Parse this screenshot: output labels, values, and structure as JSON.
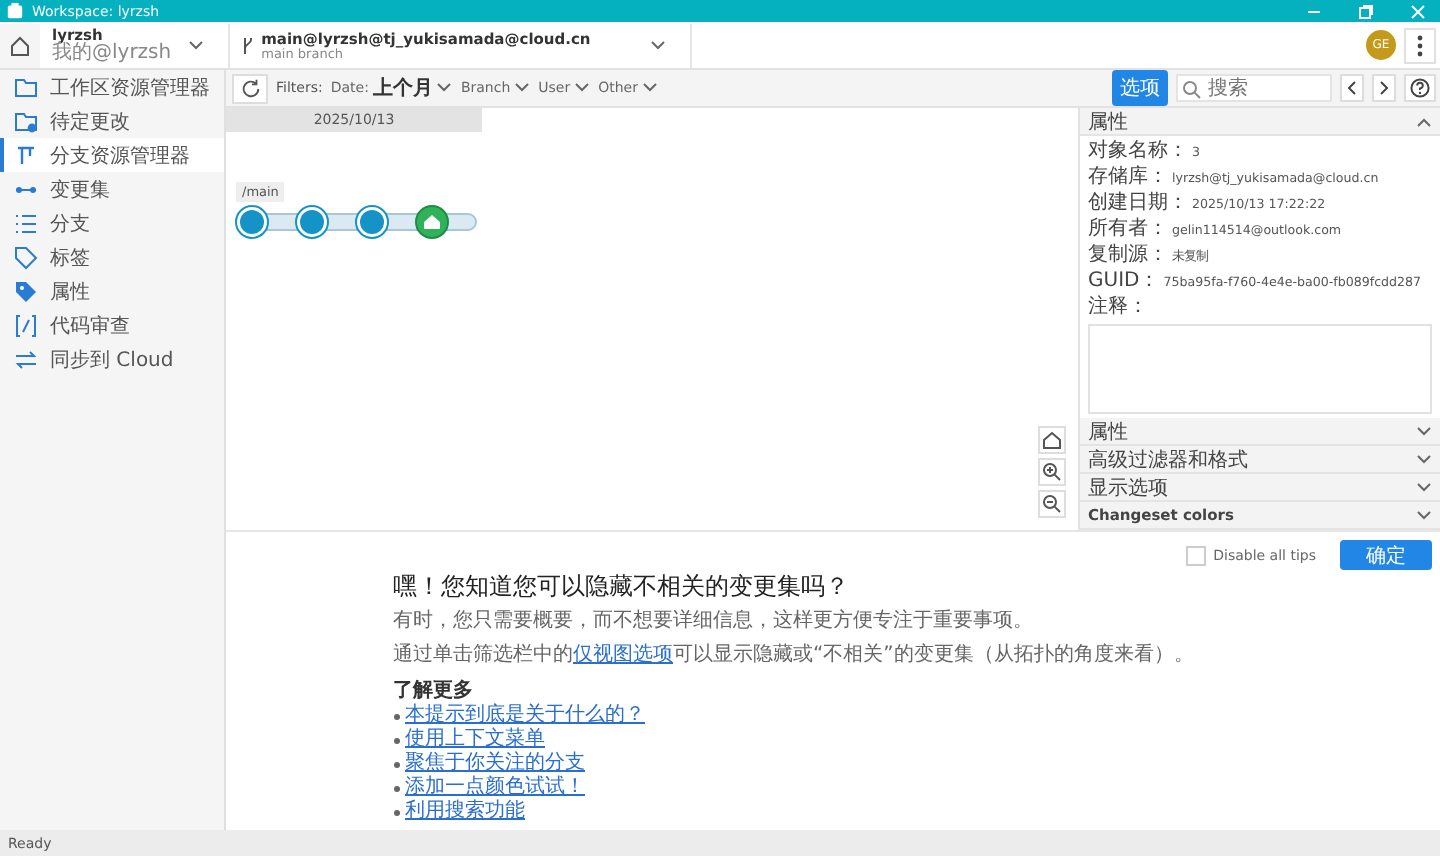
{
  "window": {
    "title": "Workspace: lyrzsh",
    "avatar": "GE"
  },
  "workspace": {
    "name": "lyrzsh",
    "subtitle": "我的@lyrzsh"
  },
  "branch": {
    "name": "main@lyrzsh@tj_yukisamada@cloud.cn",
    "subtitle": "main branch"
  },
  "sidebar": {
    "items": [
      {
        "label": "工作区资源管理器",
        "selected": false
      },
      {
        "label": "待定更改",
        "selected": false
      },
      {
        "label": "分支资源管理器",
        "selected": true
      },
      {
        "label": "变更集",
        "selected": false
      },
      {
        "label": "分支",
        "selected": false
      },
      {
        "label": "标签",
        "selected": false
      },
      {
        "label": "属性",
        "selected": false
      },
      {
        "label": "代码审查",
        "selected": false
      },
      {
        "label": "同步到 Cloud",
        "selected": false
      }
    ]
  },
  "filters": {
    "label": "Filters:",
    "items": [
      {
        "label": "Date:",
        "value": "上个月"
      },
      {
        "label": "Branch"
      },
      {
        "label": "User"
      },
      {
        "label": "Other"
      }
    ]
  },
  "toolbar": {
    "options_button": "选项",
    "search": {
      "placeholder": "搜索"
    }
  },
  "graph": {
    "date": "2025/10/13",
    "branch_label": "/main",
    "nodes": [
      {
        "kind": "changeset"
      },
      {
        "kind": "changeset"
      },
      {
        "kind": "changeset"
      },
      {
        "kind": "head"
      }
    ]
  },
  "properties": {
    "title": "属性",
    "expanded": true,
    "fields": [
      {
        "label": "对象名称：",
        "value": "3"
      },
      {
        "label": "存储库：",
        "value": "lyrzsh@tj_yukisamada@cloud.cn"
      },
      {
        "label": "创建日期：",
        "value": "2025/10/13 17:22:22"
      },
      {
        "label": "所有者：",
        "value": "gelin114514@outlook.com"
      },
      {
        "label": "复制源：",
        "value": "未复制"
      },
      {
        "label": "GUID：",
        "value": "75ba95fa-f760-4e4e-ba00-fb089fcdd287"
      }
    ],
    "comment_label": "注释："
  },
  "sections": [
    {
      "title": "属性",
      "expanded": false
    },
    {
      "title": "高级过滤器和格式",
      "expanded": false
    },
    {
      "title": "显示选项",
      "expanded": false
    },
    {
      "title": "Changeset colors",
      "expanded": false
    }
  ],
  "tip": {
    "disable_label": "Disable all tips",
    "disable_checked": false,
    "ok_button": "确定",
    "title": "嘿！您知道您可以隐藏不相关的变更集吗？",
    "line_1": "有时，您只需要概要，而不想要详细信息，这样更方便专注于重要事项。",
    "line_2_before": "通过单击筛选栏中的",
    "line_2_link": "仅视图选项",
    "line_2_after": "可以显示隐藏或“不相关”的变更集（从拓扑的角度来看）。",
    "learn_more": "了解更多",
    "links": [
      "本提示到底是关于什么的？",
      "使用上下文菜单",
      "聚焦于你关注的分支",
      "添加一点颜色试试！",
      "利用搜索功能"
    ]
  },
  "status_bar": "Ready"
}
